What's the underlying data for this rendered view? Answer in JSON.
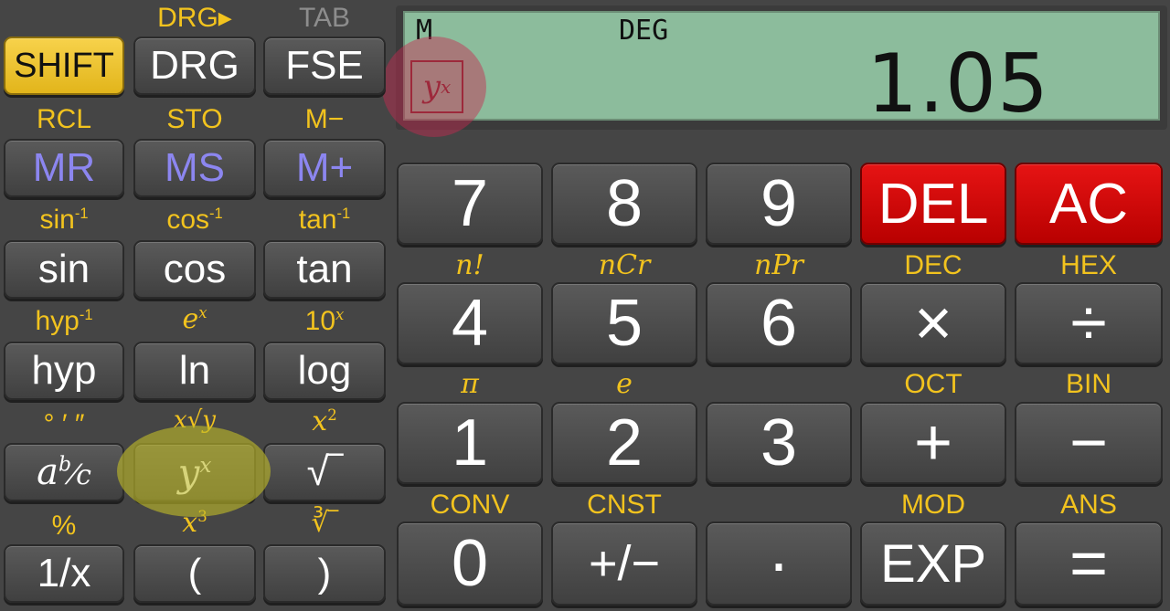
{
  "display": {
    "indicator_memory": "M",
    "indicator_angle": "DEG",
    "value": "1.05",
    "last_op_icon": "yx-icon"
  },
  "left_pad": {
    "row1": {
      "shift": {
        "label": "SHIFT"
      },
      "drg": {
        "label": "DRG",
        "secondary": "DRG▸"
      },
      "fse": {
        "label": "FSE",
        "secondary": "TAB"
      }
    },
    "row2": {
      "mr": {
        "label": "MR",
        "secondary": "RCL"
      },
      "ms": {
        "label": "MS",
        "secondary": "STO"
      },
      "mplus": {
        "label": "M+",
        "secondary": "M−"
      }
    },
    "row3": {
      "sin": {
        "label": "sin",
        "secondary": "sin"
      },
      "cos": {
        "label": "cos",
        "secondary": "cos"
      },
      "tan": {
        "label": "tan",
        "secondary": "tan"
      },
      "inverse_exp": "-1"
    },
    "row4": {
      "hyp": {
        "label": "hyp",
        "secondary": "hyp"
      },
      "ln": {
        "label": "ln",
        "secondary": "e"
      },
      "log": {
        "label": "log",
        "secondary": "10"
      }
    },
    "row5": {
      "frac": {
        "label": "a",
        "label_b": "b",
        "label_c": "⁄c",
        "secondary": "° ′ ″"
      },
      "pow": {
        "label": "y",
        "sup": "x",
        "secondary": "x√y"
      },
      "sqrt": {
        "label": "√‾",
        "secondary": "x",
        "secondary_sup": "2"
      }
    },
    "row6": {
      "recip": {
        "label": "1/x",
        "secondary": "%"
      },
      "lparen": {
        "label": "(",
        "secondary": "x",
        "secondary_sup": "3"
      },
      "rparen": {
        "label": ")",
        "secondary": "∛‾"
      }
    }
  },
  "right_pad": {
    "row1": [
      "7",
      "8",
      "9",
      "DEL",
      "AC"
    ],
    "row2_secondary": [
      "n!",
      "nCr",
      "nPr",
      "DEC",
      "HEX"
    ],
    "row2": [
      "4",
      "5",
      "6",
      "×",
      "÷"
    ],
    "row3_secondary": [
      "π",
      "e",
      "",
      "OCT",
      "BIN"
    ],
    "row3": [
      "1",
      "2",
      "3",
      "+",
      "−"
    ],
    "row4_secondary": [
      "CONV",
      "CNST",
      "",
      "MOD",
      "ANS"
    ],
    "row4": [
      "0",
      "+/−",
      "·",
      "EXP",
      "="
    ]
  },
  "colors": {
    "accent_label": "#f2c31e",
    "shift": "#f0c52b",
    "memory": "#8c86f0",
    "danger": "#d10a0a",
    "lcd": "#8cbc9c"
  }
}
